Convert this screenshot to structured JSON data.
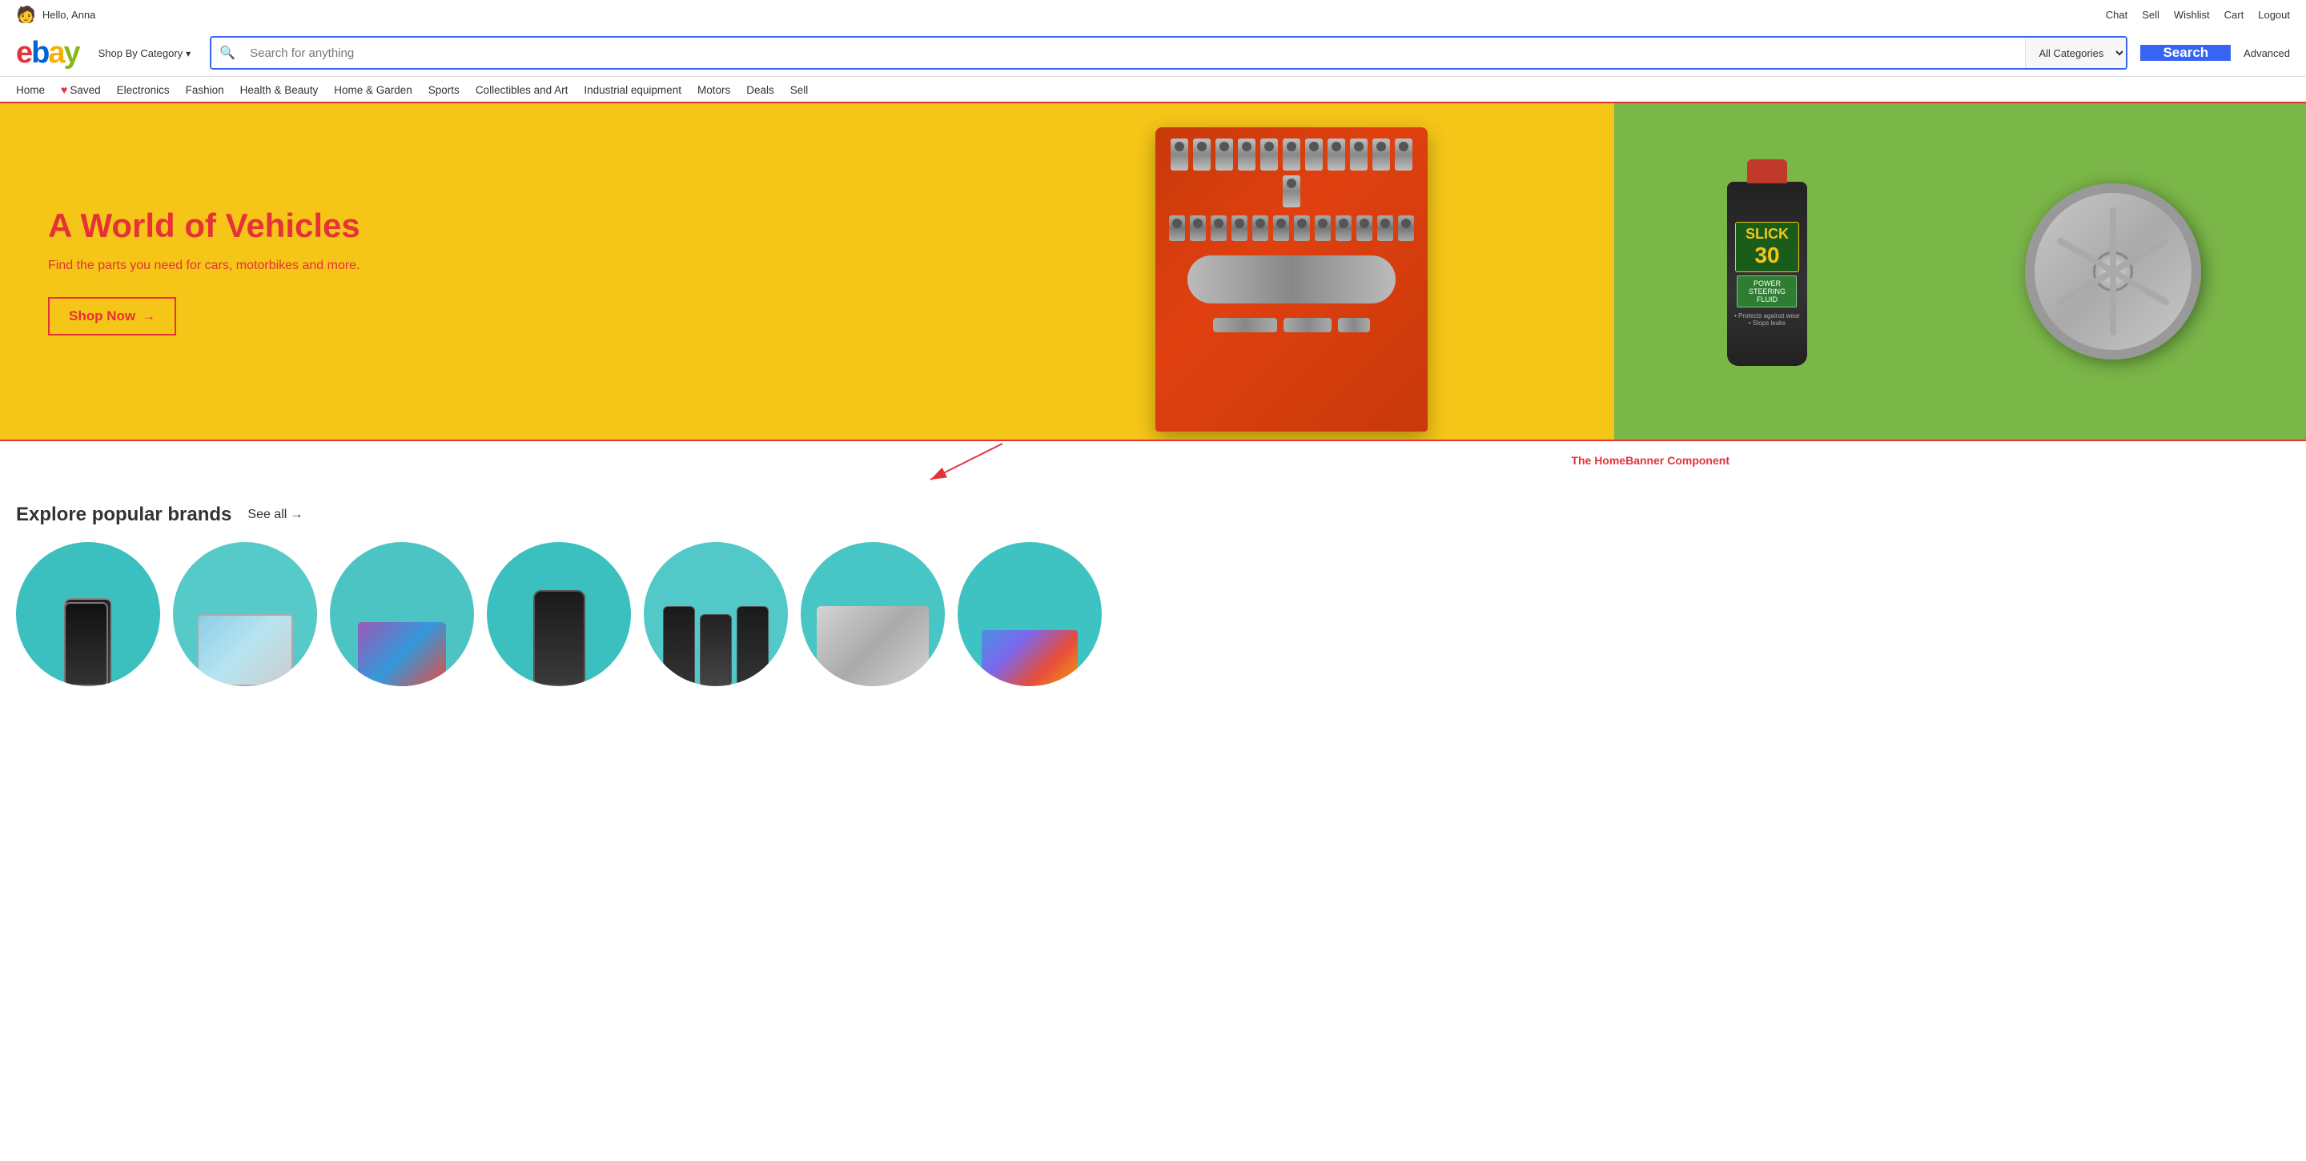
{
  "topbar": {
    "greeting": "Hello, Anna",
    "links": [
      "Chat",
      "Sell",
      "Wishlist",
      "Cart",
      "Logout"
    ]
  },
  "header": {
    "logo": {
      "letters": [
        "e",
        "b",
        "a",
        "y"
      ]
    },
    "shop_by_category": "Shop By Category",
    "search_placeholder": "Search for anything",
    "category_default": "All Categories",
    "search_button": "Search",
    "advanced": "Advanced"
  },
  "nav": {
    "items": [
      {
        "label": "Home",
        "icon": null
      },
      {
        "label": "Saved",
        "icon": "heart"
      },
      {
        "label": "Electronics",
        "icon": null
      },
      {
        "label": "Fashion",
        "icon": null
      },
      {
        "label": "Health & Beauty",
        "icon": null
      },
      {
        "label": "Home & Garden",
        "icon": null
      },
      {
        "label": "Sports",
        "icon": null
      },
      {
        "label": "Collectibles and Art",
        "icon": null
      },
      {
        "label": "Industrial equipment",
        "icon": null
      },
      {
        "label": "Motors",
        "icon": null
      },
      {
        "label": "Deals",
        "icon": null
      },
      {
        "label": "Sell",
        "icon": null
      }
    ]
  },
  "banner": {
    "title": "A World of Vehicles",
    "subtitle": "Find the parts you need for cars, motorbikes and more.",
    "cta": "Shop Now",
    "oil_brand": "SLICK",
    "oil_brand_num": "30",
    "oil_subtitle": "POWER\nSTEERING FLUID",
    "annotation": "The HomeBanner Component"
  },
  "brands": {
    "title": "Explore popular brands",
    "see_all": "See all",
    "arrow": "→",
    "items": [
      {
        "id": 1
      },
      {
        "id": 2
      },
      {
        "id": 3
      },
      {
        "id": 4
      },
      {
        "id": 5
      },
      {
        "id": 6
      },
      {
        "id": 7
      }
    ]
  }
}
